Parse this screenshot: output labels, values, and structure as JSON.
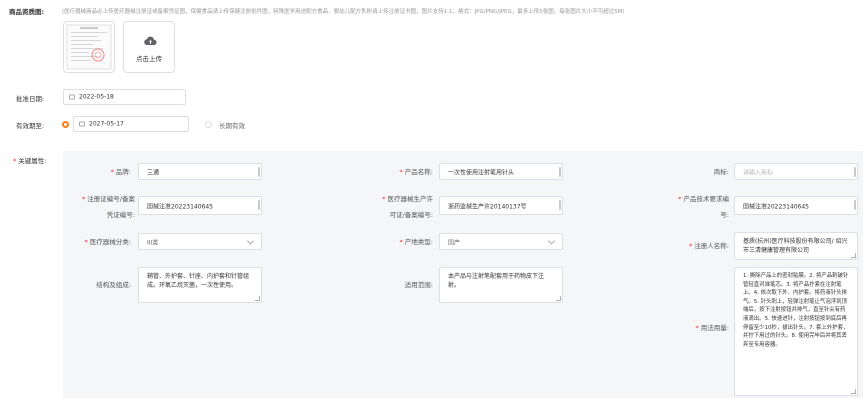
{
  "product_images": {
    "label": "商品资质图:",
    "hint": "(医疗器械商品必上传医疗器械注册证或备案凭证图，保健食品请上传保健注册批件图，特殊医学用途配方食品、婴幼儿配方乳粉请上传注册证书图，图片支持1:1，格式：JPG/PNG/JPEG，最多上传5张图，每张图片大小不可超过5M)",
    "upload_label": "点击上传",
    "upload_icon": "cloud-upload-icon"
  },
  "approval_date": {
    "label": "批准日期:",
    "value": "2022-05-18"
  },
  "validity": {
    "label": "有效期至:",
    "value": "2027-05-17",
    "long_term_label": "长期有效",
    "selected": "date",
    "accent": "#ff7a1a"
  },
  "attributes": {
    "label": "关键属性:",
    "brand": {
      "label": "品牌:",
      "value": "三通"
    },
    "product_name": {
      "label": "产品名称:",
      "value": "一次性使用注射笔用针头"
    },
    "trademark": {
      "label": "商标:",
      "placeholder": "请输入商标"
    },
    "reg_cert_no": {
      "label_line1": "注册证编号/备案",
      "label_line2": "凭证编号:",
      "value": "国械注准20223140645"
    },
    "prod_license": {
      "label_line1": "医疗器械生产许",
      "label_line2": "可证/备案编号:",
      "value": "浙药监械生产许20140137号"
    },
    "tech_req_no": {
      "label_line1": "产品技术要求编",
      "label_line2": "号:",
      "value": "国械注准20223140645"
    },
    "device_class": {
      "label": "医疗器械分类:",
      "value": "III类"
    },
    "origin_type": {
      "label": "产地类型:",
      "value": "国产"
    },
    "registrant": {
      "label": "注册人名称:",
      "value": "基质(杭州)医疗科技股份有限公司/ 绍兴市三清健康管理有限公司"
    },
    "structure": {
      "label": "结构及组成:",
      "value": "鞘管、外护套、针座、内护套和针管组成。环氧乙烷灭菌，一次性使用。"
    },
    "scope": {
      "label": "适用范围:",
      "value": "本产品与注射笔配套用于药物皮下注射。"
    },
    "usage": {
      "label": "用法用量:",
      "value": "1. 撕除产品上的密封贴膜。2. 将产品刺破针管轻直对准笔芯。3. 将产品拧紧在注射笔上。4. 依次取下外、内护套。将药液针头排气。5. 针头刺上，轻弹注射笔让气泡浮到顶端后，按下注射按钮并排气，直至针尖有药液滴出。5. 快速进针，注射按钮按到底后再停留至少10秒，拔出针头。7. 套上外护套，并拧下用过的针头。8. 使用完毕后并将其丢弃至专用容器。"
    }
  }
}
